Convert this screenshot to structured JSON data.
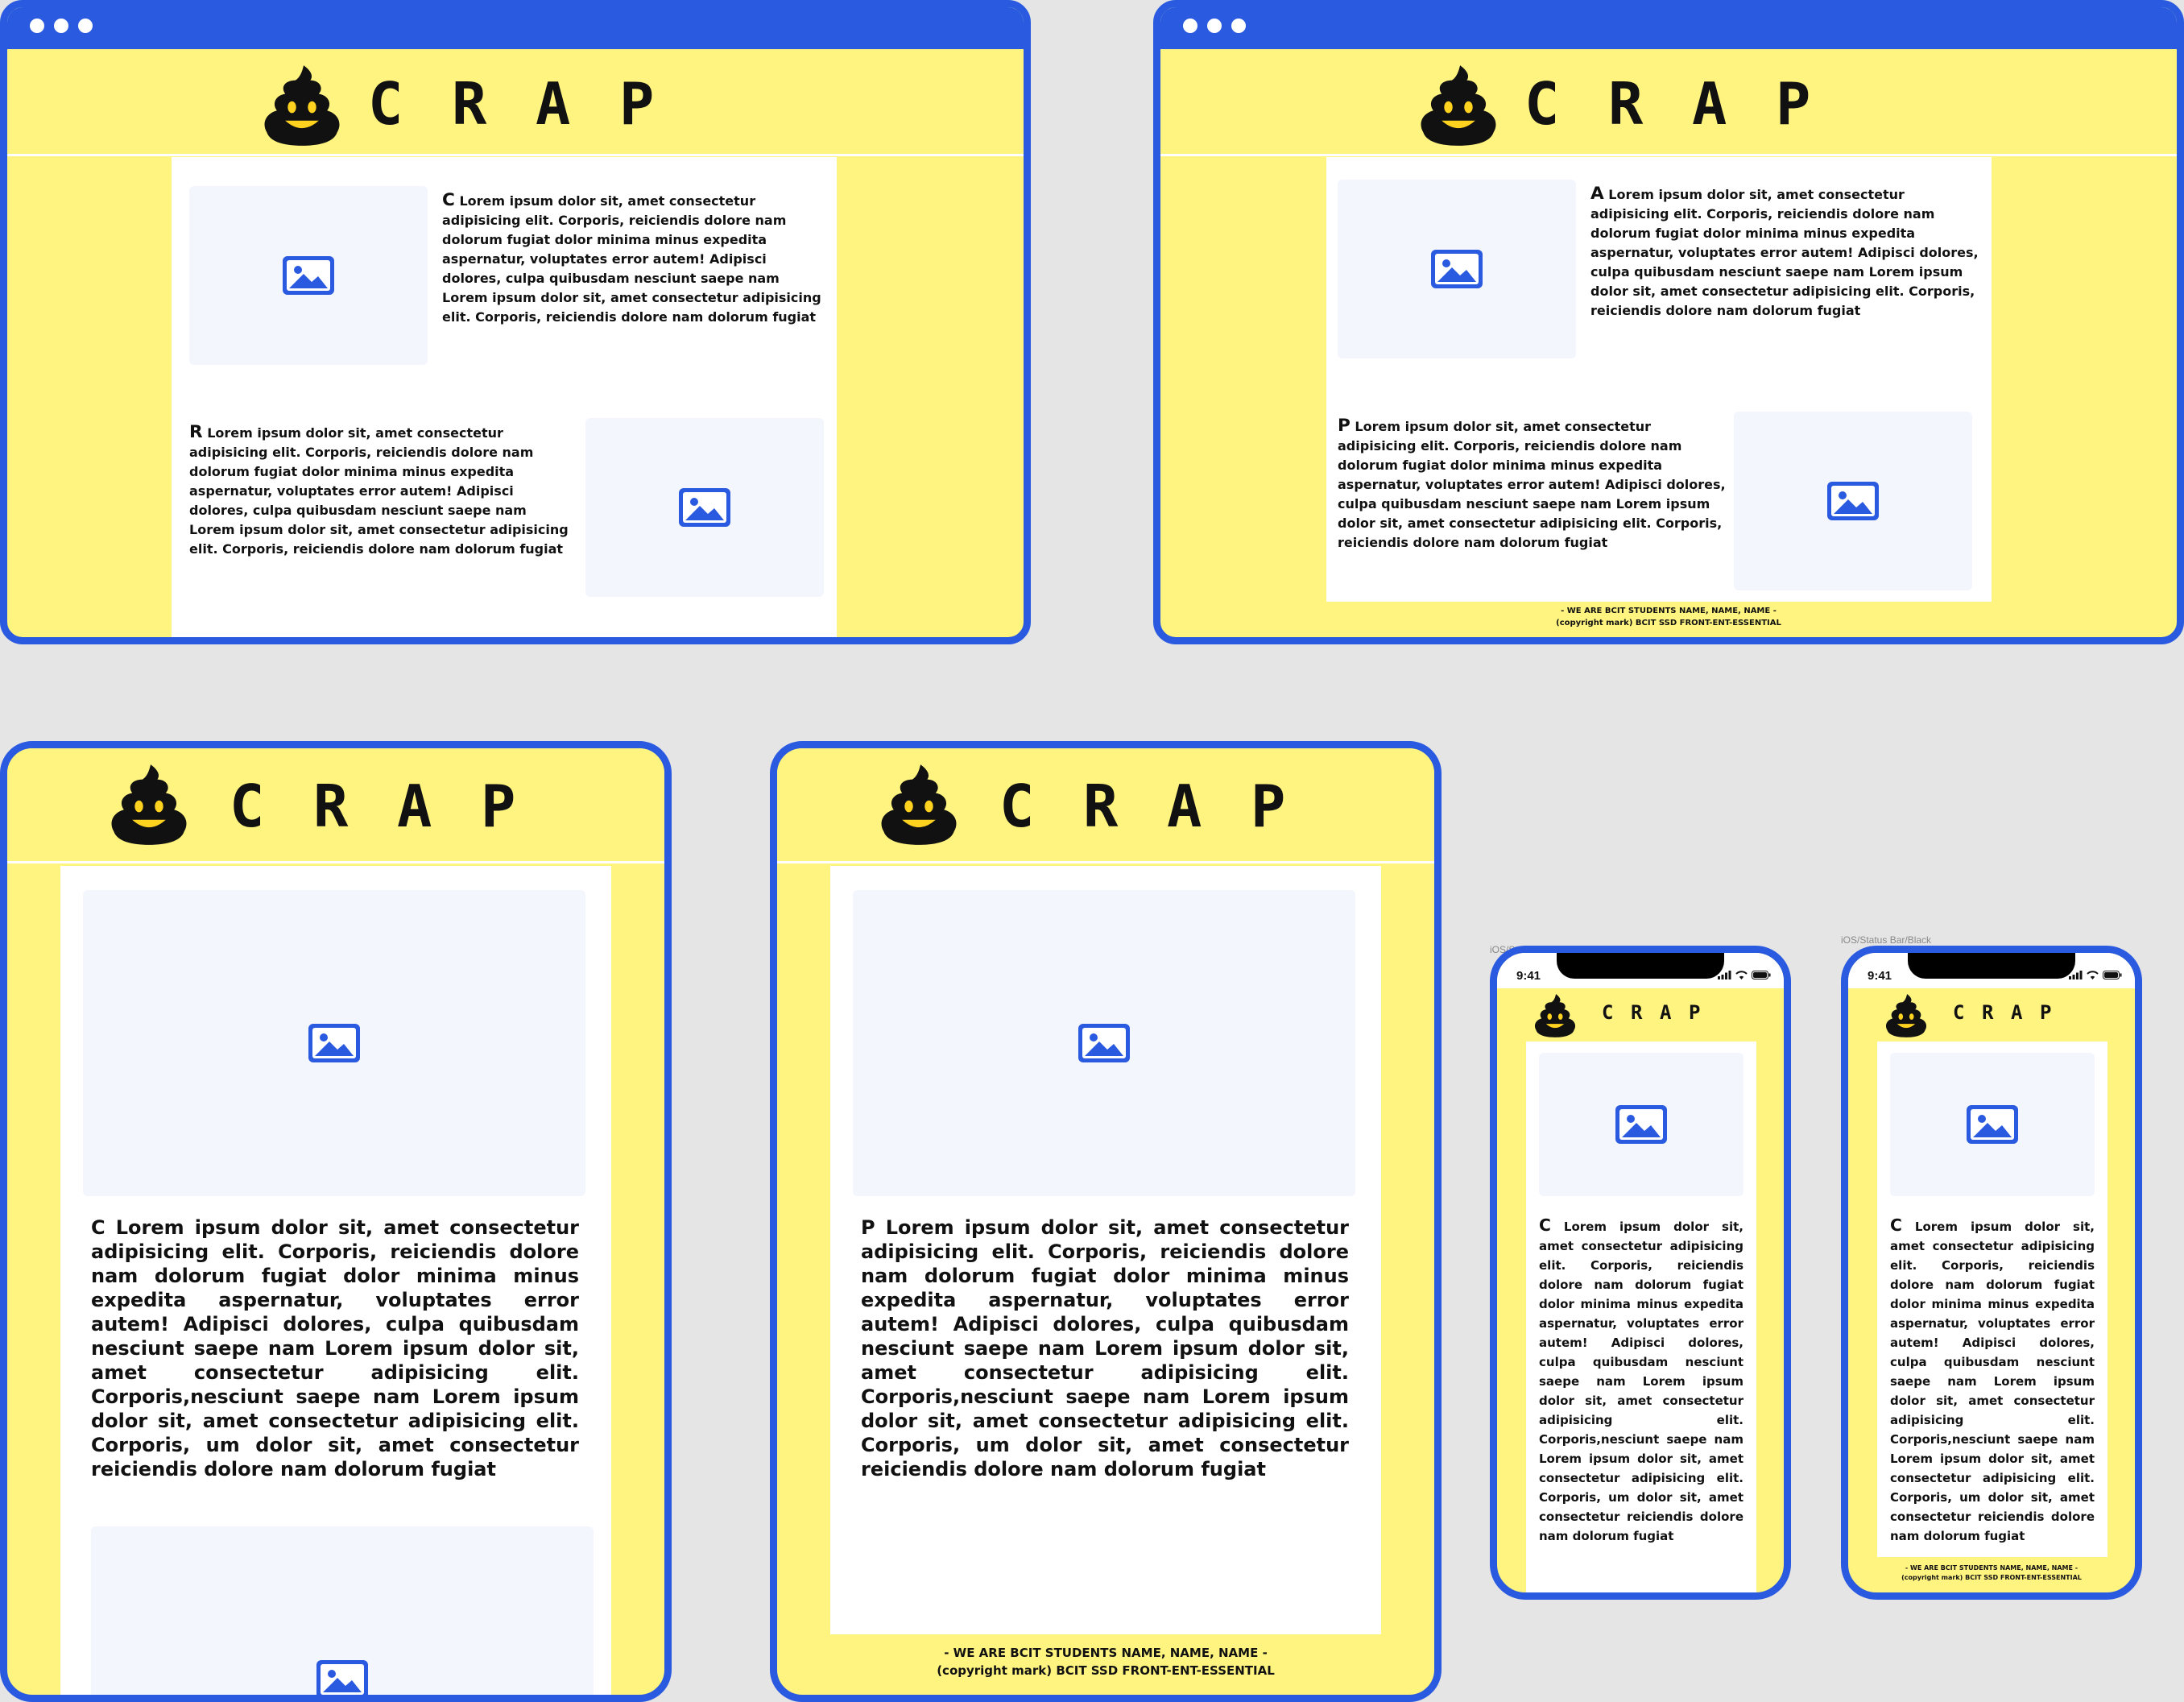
{
  "brand": {
    "letters": [
      "C",
      "R",
      "A",
      "P"
    ],
    "logo": "poop-emoji-icon"
  },
  "colors": {
    "accent": "#2a5ae0",
    "yellow": "#fff47f",
    "placeholder": "#f3f6fc",
    "background": "#e5e5e5"
  },
  "icons": {
    "image": "image-icon",
    "window_dot": "window-dot"
  },
  "text": {
    "short_body": "Lorem ipsum dolor sit, amet consectetur adipisicing elit. Corporis, reiciendis dolore nam dolorum fugiat dolor minima minus expedita aspernatur, voluptates error autem! Adipisci dolores, culpa quibusdam nesciunt saepe nam Lorem ipsum dolor sit, amet consectetur adipisicing elit. Corporis, reiciendis dolore nam dolorum fugiat",
    "long_body": "Lorem ipsum dolor sit, amet consectetur adipisicing elit. Corporis, reiciendis dolore nam dolorum fugiat dolor minima minus expedita aspernatur, voluptates error autem! Adipisci dolores, culpa quibusdam nesciunt saepe nam Lorem ipsum dolor sit, amet consectetur adipisicing elit. Corporis,nesciunt saepe nam Lorem ipsum dolor sit, amet consectetur adipisicing elit. Corporis, um dolor sit, amet consectetur reiciendis dolore nam dolorum fugiat"
  },
  "footer": {
    "line1": "- WE ARE BCIT STUDENTS NAME, NAME, NAME -",
    "line2": "(copyright mark) BCIT SSD FRONT-ENT-ESSENTIAL"
  },
  "desktop_1": {
    "para1_initial": "C",
    "para2_initial": "R"
  },
  "desktop_2": {
    "para1_initial": "A",
    "para2_initial": "P"
  },
  "tablet_1": {
    "initial": "C"
  },
  "tablet_2": {
    "initial": "P"
  },
  "phone_1": {
    "time": "9:41",
    "label": "iOS/Status Bar/Black",
    "initial": "C"
  },
  "phone_2": {
    "time": "9:41",
    "label": "iOS/Status Bar/Black",
    "initial": "C"
  }
}
